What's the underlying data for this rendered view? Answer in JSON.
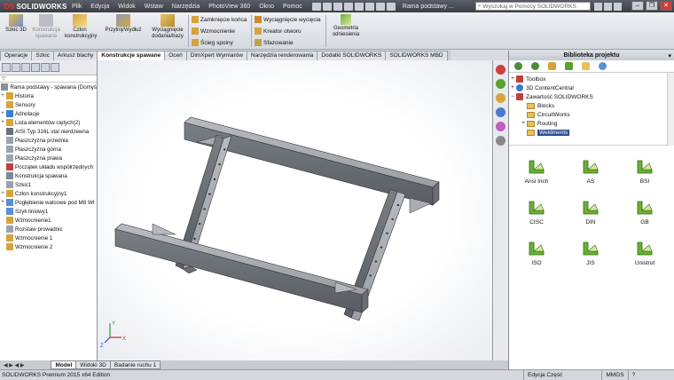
{
  "app": {
    "logo": "SOLIDWORKS",
    "doc_title": "Rama podstawy ...",
    "search_placeholder": "Wyszukaj w Pomocy SOLIDWORKS"
  },
  "menu": [
    "Plik",
    "Edycja",
    "Widok",
    "Wstaw",
    "Narzędzia",
    "PhotoView 360",
    "Okno",
    "Pomoc"
  ],
  "command_manager": {
    "big": [
      {
        "label": "Szkic 3D"
      },
      {
        "label": "Konstrukcja spawana"
      },
      {
        "label": "Człon konstrukcyjny"
      },
      {
        "label": "Przytnij/Wydłuż"
      },
      {
        "label": "Wyciągnięcie dodania/bazy"
      }
    ],
    "group1": [
      "Zamknięcie końca",
      "Wzmocnienie",
      "Ścieg spoiny"
    ],
    "group2": [
      "Wyciągnięcie wycięcia",
      "Kreator otworu",
      "Sfazowanie"
    ],
    "geometry": "Geometria odniesienia"
  },
  "tabs": [
    "Operacje",
    "Szkic",
    "Arkusz blachy",
    "Konstrukcje spawane",
    "Oceń",
    "DimXpert Wymiarów",
    "Narzędzia renderowania",
    "Dodatki SOLIDWORKS",
    "SOLIDWORKS MBD"
  ],
  "active_tab": "Konstrukcje spawane",
  "tree": [
    {
      "label": "Rama podstawy - spawana  (Domyś",
      "exp": "",
      "color": "#8a8f99"
    },
    {
      "label": "Historia",
      "exp": "+",
      "color": "#d9a33b"
    },
    {
      "label": "Sensory",
      "exp": "",
      "color": "#d9a33b"
    },
    {
      "label": "Adnotacje",
      "exp": "+",
      "color": "#3d7fd1"
    },
    {
      "label": "Lista elementów ciętych(2)",
      "exp": "+",
      "color": "#d9a33b"
    },
    {
      "label": "AISI Typ 316L stal nierdzewna",
      "exp": "",
      "color": "#6a6f78"
    },
    {
      "label": "Płaszczyzna przednia",
      "exp": "",
      "color": "#9aa3b0"
    },
    {
      "label": "Płaszczyzna górna",
      "exp": "",
      "color": "#9aa3b0"
    },
    {
      "label": "Płaszczyzna prawa",
      "exp": "",
      "color": "#9aa3b0"
    },
    {
      "label": "Początek układu współrzędnych",
      "exp": "",
      "color": "#c04040"
    },
    {
      "label": "Konstrukcja spawana",
      "exp": "",
      "color": "#7a8a9a"
    },
    {
      "label": "Szkic1",
      "exp": "",
      "color": "#9aa3b0"
    },
    {
      "label": "Człon konstrukcyjny1",
      "exp": "+",
      "color": "#d9a33b"
    },
    {
      "label": "Pogłębienie walcowe pod M8 Wł",
      "exp": "+",
      "color": "#5a8fd0"
    },
    {
      "label": "Szyk liniowy1",
      "exp": "",
      "color": "#5a8fd0"
    },
    {
      "label": "Wzmocnienie1",
      "exp": "",
      "color": "#d9a33b"
    },
    {
      "label": "Rozstaw prowadnic",
      "exp": "",
      "color": "#9aa3b0"
    },
    {
      "label": "Wzmocnienie 1",
      "exp": "",
      "color": "#d9a33b"
    },
    {
      "label": "Wzmocnienie 2",
      "exp": "",
      "color": "#d9a33b"
    }
  ],
  "bottom_tabs": [
    "Model",
    "Widoki 3D",
    "Badanie ruchu 1"
  ],
  "active_bottom_tab": "Model",
  "status": {
    "left": "SOLIDWORKS Premium 2015 x64 Edition",
    "edit": "Edycja Część",
    "units": "MMGS",
    "help": "?"
  },
  "library": {
    "title": "Biblioteka projektu",
    "tree": [
      {
        "label": "Toolbox",
        "exp": "+",
        "kind": "toolbox"
      },
      {
        "label": "3D ContentCentral",
        "exp": "+",
        "kind": "globe"
      },
      {
        "label": "Zawartość SOLIDWORKS",
        "exp": "−",
        "kind": "sw"
      },
      {
        "label": "Blocks",
        "exp": "",
        "kind": "folder"
      },
      {
        "label": "CircuitWorks",
        "exp": "",
        "kind": "folder"
      },
      {
        "label": "Routing",
        "exp": "+",
        "kind": "folder"
      },
      {
        "label": "Weldments",
        "exp": "",
        "kind": "folder",
        "selected": true
      }
    ],
    "items": [
      "Ansi Inch",
      "AS",
      "BSI",
      "CISC",
      "DIN",
      "GB",
      "ISO",
      "JIS",
      "Unistrut"
    ]
  },
  "colors": {
    "accent": "#2c4e8a",
    "frame": "#8c9096",
    "icon_green": "#5aa02c"
  },
  "icons": [
    "save-icon",
    "undo-icon",
    "rebuild-icon",
    "options-icon",
    "search-icon",
    "triad-icon"
  ]
}
